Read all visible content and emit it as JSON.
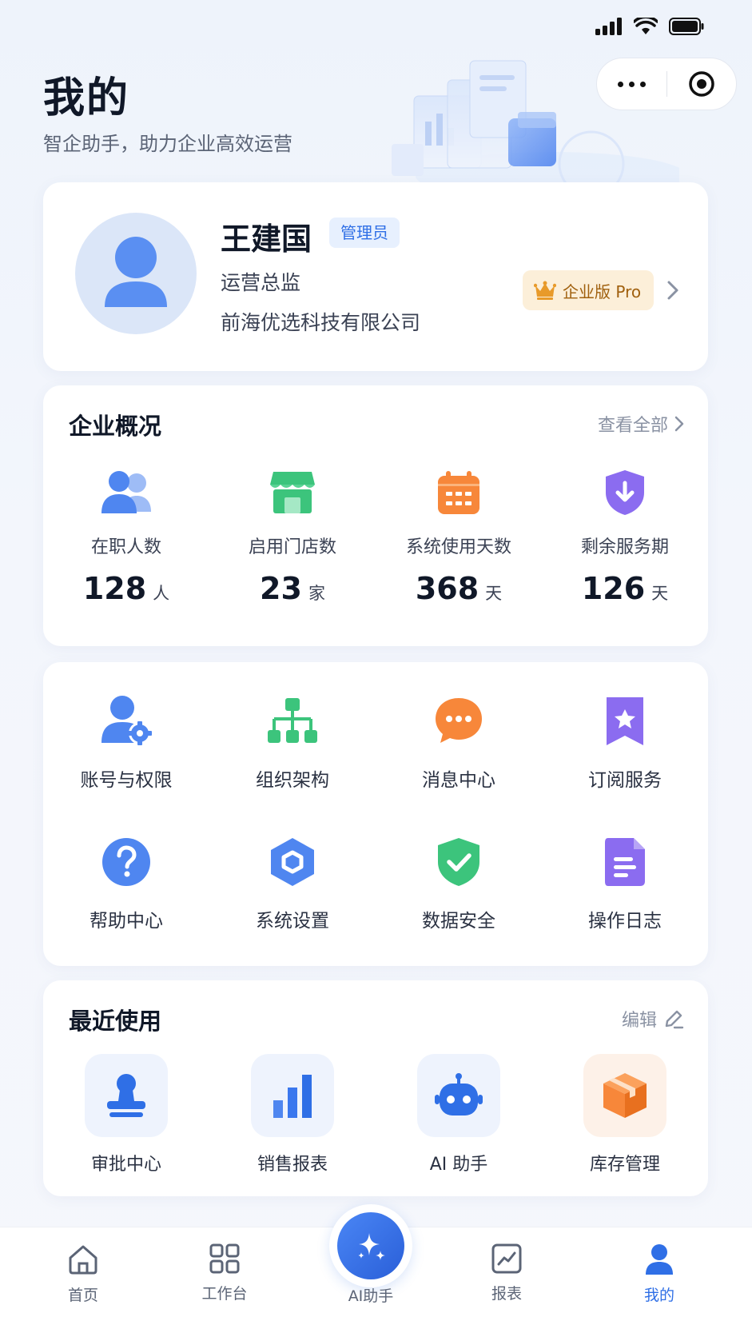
{
  "header": {
    "title": "我的",
    "subtitle": "智企助手，助力企业高效运营"
  },
  "profile": {
    "name": "王建国",
    "role_badge": "管理员",
    "title": "运营总监",
    "company": "前海优选科技有限公司",
    "plan_badge": "企业版 Pro"
  },
  "overview": {
    "title": "企业概况",
    "view_all": "查看全部",
    "stats": [
      {
        "label": "在职人数",
        "value": "128",
        "unit": "人",
        "icon": "users-icon",
        "color": "#4f86f0"
      },
      {
        "label": "启用门店数",
        "value": "23",
        "unit": "家",
        "icon": "store-icon",
        "color": "#3cc47c"
      },
      {
        "label": "系统使用天数",
        "value": "368",
        "unit": "天",
        "icon": "calendar-icon",
        "color": "#f7873a"
      },
      {
        "label": "剩余服务期",
        "value": "126",
        "unit": "天",
        "icon": "shield-download-icon",
        "color": "#8b6cf0"
      }
    ]
  },
  "menu": {
    "items": [
      {
        "label": "账号与权限",
        "icon": "user-gear-icon"
      },
      {
        "label": "组织架构",
        "icon": "org-chart-icon"
      },
      {
        "label": "消息中心",
        "icon": "chat-bubble-icon"
      },
      {
        "label": "订阅服务",
        "icon": "bookmark-star-icon"
      },
      {
        "label": "帮助中心",
        "icon": "help-circle-icon"
      },
      {
        "label": "系统设置",
        "icon": "hexagon-settings-icon"
      },
      {
        "label": "数据安全",
        "icon": "shield-check-icon"
      },
      {
        "label": "操作日志",
        "icon": "document-icon"
      }
    ]
  },
  "recent": {
    "title": "最近使用",
    "edit": "编辑",
    "items": [
      {
        "label": "审批中心",
        "icon": "stamp-icon"
      },
      {
        "label": "销售报表",
        "icon": "bar-chart-icon"
      },
      {
        "label": "AI 助手",
        "icon": "robot-icon"
      },
      {
        "label": "库存管理",
        "icon": "box-icon"
      }
    ]
  },
  "tabbar": {
    "items": [
      {
        "label": "首页",
        "icon": "home-icon"
      },
      {
        "label": "工作台",
        "icon": "grid-icon"
      },
      {
        "label": "AI助手",
        "icon": "sparkle-icon"
      },
      {
        "label": "报表",
        "icon": "line-chart-icon"
      },
      {
        "label": "我的",
        "icon": "person-icon",
        "active": true
      }
    ]
  },
  "colors": {
    "accent": "#2f6fe6",
    "pro_badge_bg": "#fcefd9",
    "pro_badge_text": "#a0600e"
  }
}
